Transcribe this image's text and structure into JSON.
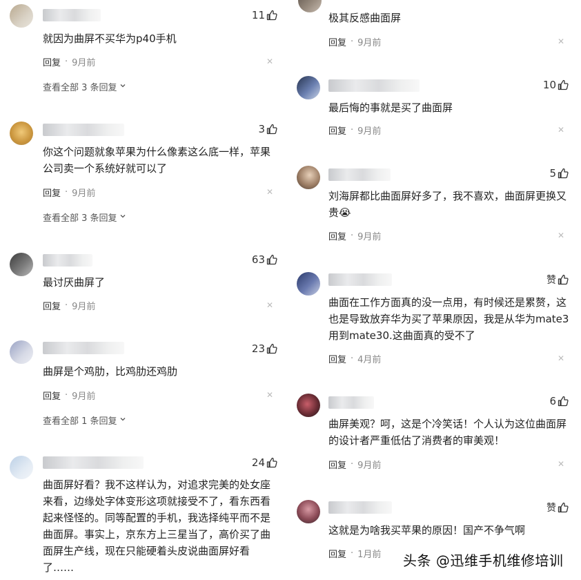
{
  "left_comments": [
    {
      "likes": "11",
      "text": "就因为曲屏不买华为p40手机",
      "reply": "回复",
      "time": "9月前",
      "more": "查看全部 3 条回复"
    },
    {
      "likes": "3",
      "text": "你这个问题就象苹果为什么像素这么底一样，苹果公司卖一个系统好就可以了",
      "reply": "回复",
      "time": "9月前",
      "more": "查看全部 3 条回复"
    },
    {
      "likes": "63",
      "text": "最讨厌曲屏了",
      "reply": "回复",
      "time": "9月前"
    },
    {
      "likes": "23",
      "text": "曲屏是个鸡肋，比鸡肋还鸡肋",
      "reply": "回复",
      "time": "9月前",
      "more": "查看全部 1 条回复"
    },
    {
      "likes": "24",
      "text": "曲面屏好看？我不这样认为，对追求完美的处女座来看，边缘处字体变形这项就接受不了，看东西看起来怪怪的。同等配置的手机，我选择纯平而不是曲面屏。事实上，京东方上三星当了，高价买了曲面屏生产线，现在只能硬着头皮说曲面屏好看了……"
    }
  ],
  "right_comments": [
    {
      "text": "极其反感曲面屏",
      "reply": "回复",
      "time": "9月前"
    },
    {
      "likes": "10",
      "text": "最后悔的事就是买了曲面屏",
      "reply": "回复",
      "time": "9月前"
    },
    {
      "likes": "5",
      "text": "刘海屏都比曲面屏好多了，我不喜欢，曲面屏更换又贵😭",
      "reply": "回复",
      "time": "9月前"
    },
    {
      "likes": "赞",
      "text": "曲面在工作方面真的没一点用，有时候还是累赘，这也是导致放弃华为买了苹果原因，我是从华为mate3用到mate30.这曲面真的受不了",
      "reply": "回复",
      "time": "4月前"
    },
    {
      "likes": "6",
      "text": "曲屏美观？呵，这是个冷笑话！个人认为这位曲面屏的设计者严重低估了消费者的审美观！",
      "reply": "回复",
      "time": "9月前"
    },
    {
      "likes": "赞",
      "text": "这就是为啥我买苹果的原因！国产不争气啊",
      "reply": "回复",
      "time": "1月前"
    }
  ],
  "watermark": "头条 @迅维手机维修培训",
  "icons": {
    "like": "thumbs-up-icon",
    "close": "close-icon",
    "chevron": "chevron-down-icon"
  },
  "colors": {
    "text": "#222222",
    "meta": "#888888",
    "close": "#bbbbbb"
  }
}
